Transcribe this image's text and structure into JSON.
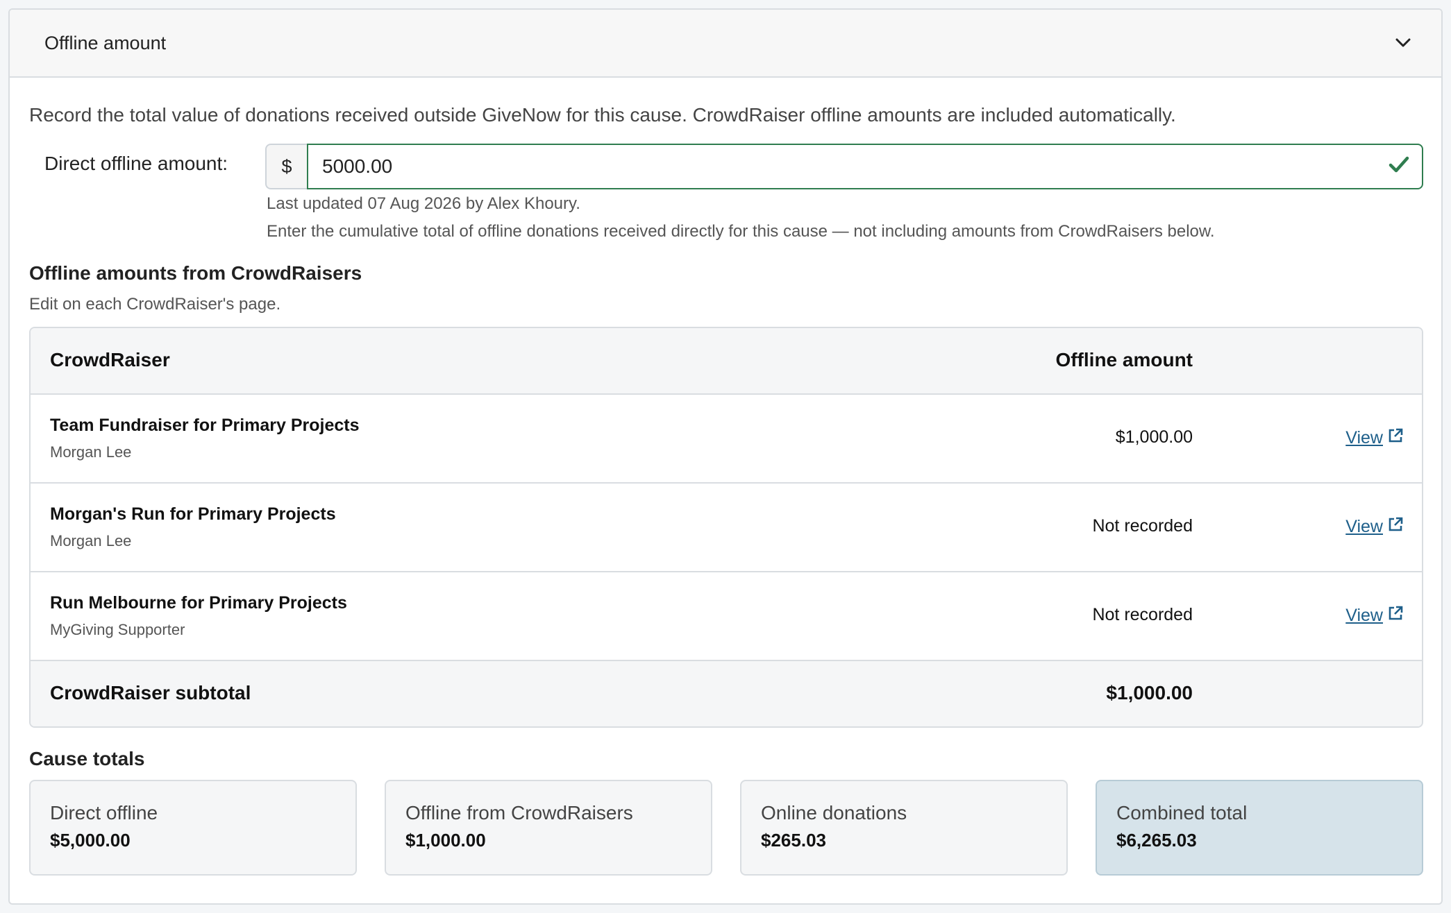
{
  "panel": {
    "title": "Offline amount",
    "chevron_icon": "chevron-down-icon"
  },
  "intro": "Record the total value of donations received outside GiveNow for this cause. CrowdRaiser offline amounts are included automatically.",
  "direct_field": {
    "label": "Direct offline amount:",
    "currency_symbol": "$",
    "value": "5000.00",
    "valid_icon": "check-icon",
    "last_updated": "Last updated 07 Aug 2026 by Alex Khoury.",
    "help": "Enter the cumulative total of offline donations received directly for this cause — not including amounts from CrowdRaisers below."
  },
  "crowdraisers": {
    "title": "Offline amounts from CrowdRaisers",
    "subtitle": "Edit on each CrowdRaiser's page.",
    "columns": {
      "name": "CrowdRaiser",
      "amount": "Offline amount"
    },
    "rows": [
      {
        "title": "Team Fundraiser for Primary Projects",
        "owner": "Morgan Lee",
        "amount": "$1,000.00",
        "link": "View"
      },
      {
        "title": "Morgan's Run for Primary Projects",
        "owner": "Morgan Lee",
        "amount": "Not recorded",
        "link": "View"
      },
      {
        "title": "Run Melbourne for Primary Projects",
        "owner": "MyGiving Supporter",
        "amount": "Not recorded",
        "link": "View"
      }
    ],
    "subtotal_label": "CrowdRaiser subtotal",
    "subtotal_value": "$1,000.00"
  },
  "totals": {
    "title": "Cause totals",
    "cards": [
      {
        "label": "Direct offline",
        "value": "$5,000.00"
      },
      {
        "label": "Offline from CrowdRaisers",
        "value": "$1,000.00"
      },
      {
        "label": "Online donations",
        "value": "$265.03"
      },
      {
        "label": "Combined total",
        "value": "$6,265.03"
      }
    ]
  },
  "colors": {
    "valid_border": "#2f7d4f",
    "link": "#1e5f8a",
    "highlight_card": "#d6e3ea"
  }
}
